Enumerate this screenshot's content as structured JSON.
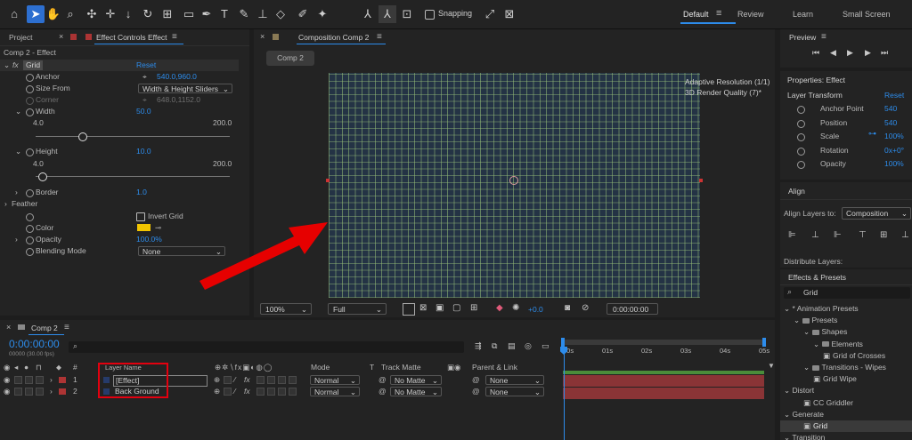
{
  "toolbar": {
    "snapping_label": "Snapping",
    "workspaces": [
      "Default",
      "Review",
      "Learn",
      "Small Screen"
    ],
    "menu_glyph": "≡"
  },
  "effect_controls": {
    "tab_project": "Project",
    "tab_effect_controls": "Effect Controls Effect",
    "layer_path": "Comp 2 - Effect",
    "effect_name": "Grid",
    "reset_label": "Reset",
    "properties": {
      "anchor": {
        "label": "Anchor",
        "value": "540.0,960.0"
      },
      "size_from": {
        "label": "Size From",
        "value": "Width & Height Sliders"
      },
      "corner": {
        "label": "Corner",
        "value": "648.0,1152.0"
      },
      "width": {
        "label": "Width",
        "value": "50.0",
        "min": "4.0",
        "max": "200.0",
        "fraction": 0.24
      },
      "height": {
        "label": "Height",
        "value": "10.0",
        "min": "4.0",
        "max": "200.0",
        "fraction": 0.03
      },
      "border": {
        "label": "Border",
        "value": "1.0"
      },
      "feather": {
        "label": "Feather"
      },
      "invert": {
        "label": "Invert Grid"
      },
      "color": {
        "label": "Color",
        "swatch": "#f2c500"
      },
      "opacity": {
        "label": "Opacity",
        "value": "100.0%"
      },
      "blending": {
        "label": "Blending Mode",
        "value": "None"
      }
    }
  },
  "composition": {
    "tab_label": "Composition Comp 2",
    "comp_tab": "Comp 2",
    "info_resolution": "Adaptive Resolution (1/1)",
    "info_quality": "3D Render Quality (7)*",
    "zoom": "100%",
    "resolution": "Full",
    "exposure": "+0.0",
    "timecode": "0:00:00:00",
    "grid_color": "#9dc07a",
    "bg_color": "#243345",
    "arrow_color": "#e60000"
  },
  "timeline": {
    "tab_label": "Comp 2",
    "timecode": "0:00:00:00",
    "frame_info": "00000 (30.00 fps)",
    "headers": {
      "hash": "#",
      "layer_name": "Layer Name",
      "mode": "Mode",
      "t": "T",
      "track_matte": "Track Matte",
      "parent": "Parent & Link"
    },
    "layers": [
      {
        "index": "1",
        "name": "[Effect]",
        "mode": "Normal",
        "matte": "No Matte",
        "parent": "None",
        "color": "#ad3434"
      },
      {
        "index": "2",
        "name": "Back Ground",
        "mode": "Normal",
        "matte": "No Matte",
        "parent": "None",
        "color": "#ad3434"
      }
    ],
    "ruler": [
      "00s",
      "01s",
      "02s",
      "03s",
      "04s",
      "05s"
    ],
    "highlight_color": "#e3000f"
  },
  "preview": {
    "title": "Preview"
  },
  "properties": {
    "title": "Properties: Effect",
    "section": "Layer Transform",
    "reset_label": "Reset",
    "rows": [
      {
        "label": "Anchor Point",
        "value": "540"
      },
      {
        "label": "Position",
        "value": "540"
      },
      {
        "label": "Scale",
        "value": "100%"
      },
      {
        "label": "Rotation",
        "value": "0x+0°"
      },
      {
        "label": "Opacity",
        "value": "100%"
      }
    ]
  },
  "align": {
    "title": "Align",
    "align_to_label": "Align Layers to:",
    "align_to_value": "Composition",
    "distribute_label": "Distribute Layers:"
  },
  "effects_presets": {
    "title": "Effects & Presets",
    "search_value": "Grid",
    "tree": [
      {
        "label": "* Animation Presets",
        "indent": 0,
        "kind": "caret"
      },
      {
        "label": "Presets",
        "indent": 1,
        "kind": "folder"
      },
      {
        "label": "Shapes",
        "indent": 2,
        "kind": "folder"
      },
      {
        "label": "Elements",
        "indent": 3,
        "kind": "folder"
      },
      {
        "label": "Grid of Crosses",
        "indent": 4,
        "kind": "item"
      },
      {
        "label": "Transitions - Wipes",
        "indent": 2,
        "kind": "folder"
      },
      {
        "label": "Grid Wipe",
        "indent": 3,
        "kind": "item"
      },
      {
        "label": "Distort",
        "indent": 0,
        "kind": "caret"
      },
      {
        "label": "CC Griddler",
        "indent": 2,
        "kind": "item"
      },
      {
        "label": "Generate",
        "indent": 0,
        "kind": "caret"
      },
      {
        "label": "Grid",
        "indent": 2,
        "kind": "item",
        "selected": true
      },
      {
        "label": "Transition",
        "indent": 0,
        "kind": "caret"
      }
    ]
  }
}
